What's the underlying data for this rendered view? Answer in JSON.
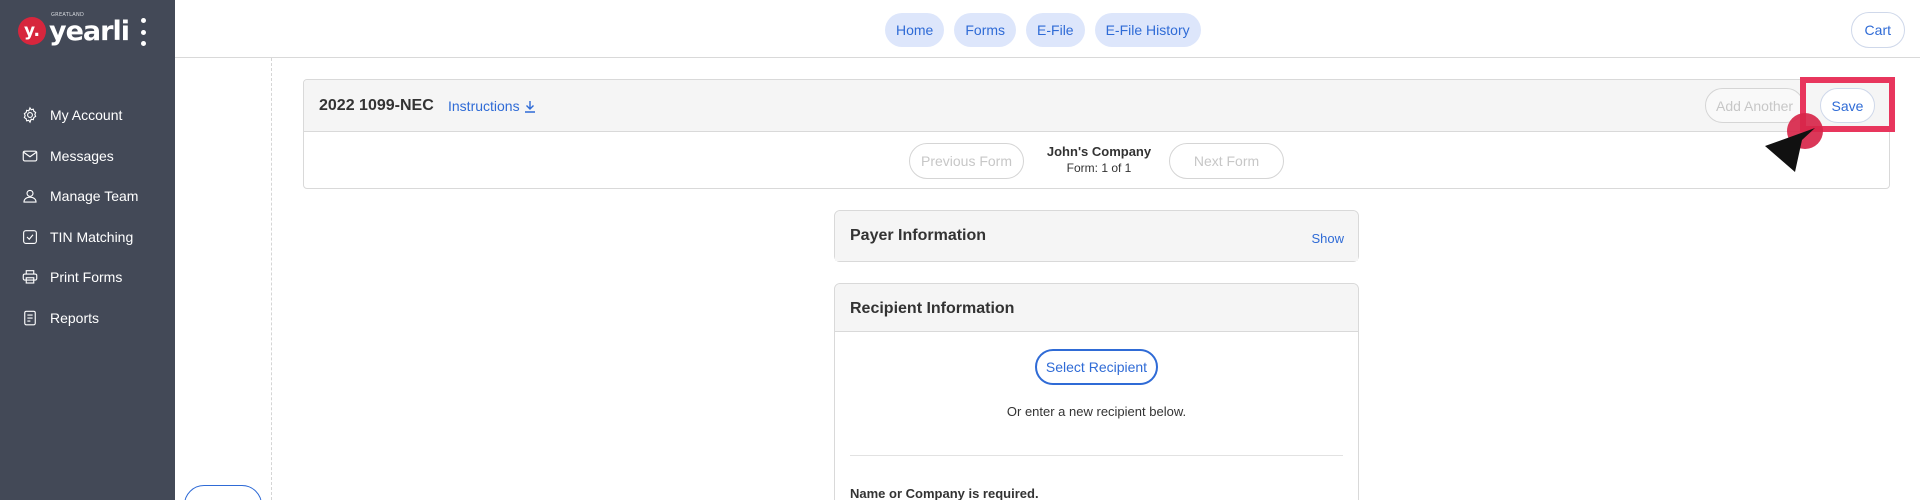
{
  "app": {
    "logo_badge": "y.",
    "logo_text": "yearli",
    "logo_sub": "GREATLAND"
  },
  "sidebar": {
    "items": [
      {
        "label": "My Account",
        "icon": "gear-icon"
      },
      {
        "label": "Messages",
        "icon": "envelope-icon"
      },
      {
        "label": "Manage Team",
        "icon": "user-icon"
      },
      {
        "label": "TIN Matching",
        "icon": "check-square-icon"
      },
      {
        "label": "Print Forms",
        "icon": "printer-icon"
      },
      {
        "label": "Reports",
        "icon": "document-icon"
      }
    ]
  },
  "topnav": {
    "items": [
      "Home",
      "Forms",
      "E-File",
      "E-File History"
    ],
    "cart_label": "Cart"
  },
  "form": {
    "title": "2022 1099-NEC",
    "instructions_label": "Instructions",
    "add_another_label": "Add Another",
    "save_label": "Save",
    "previous_label": "Previous Form",
    "next_label": "Next Form",
    "company": "John's Company",
    "form_count": "Form: 1 of 1"
  },
  "payer": {
    "title": "Payer Information",
    "show_label": "Show"
  },
  "recipient": {
    "title": "Recipient Information",
    "select_label": "Select Recipient",
    "or_text": "Or enter a new recipient below.",
    "required_text": "Name or Company is required."
  },
  "colors": {
    "sidebar_bg": "#434957",
    "accent": "#2f6bd6",
    "highlight": "#e8365d",
    "brand_red": "#d7263d"
  }
}
